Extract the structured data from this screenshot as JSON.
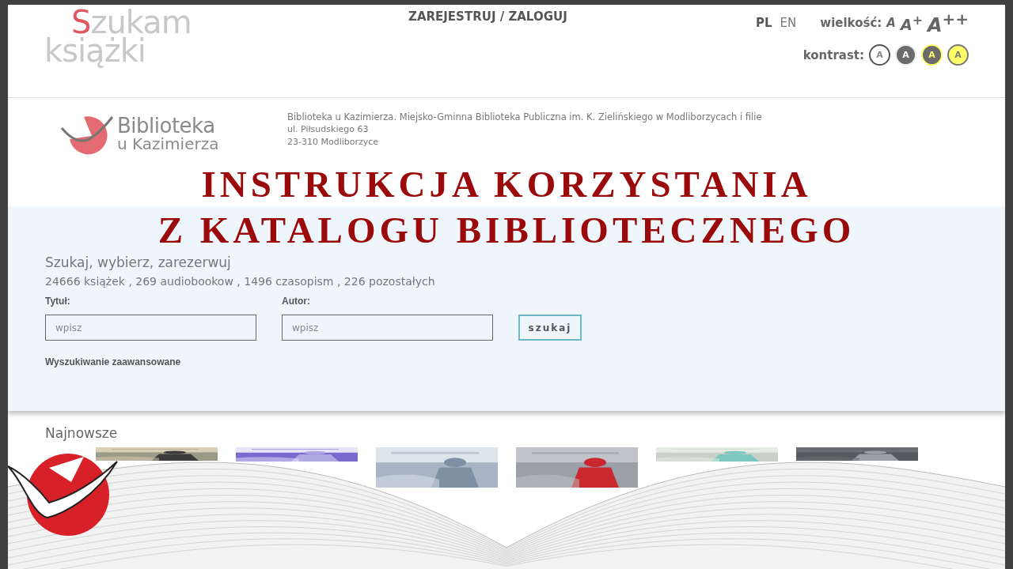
{
  "header": {
    "logo": {
      "line_1": "Szukam",
      "line_2": "książki"
    },
    "account_link": "ZAREJESTRUJ / ZALOGUJ",
    "languages": [
      {
        "label": "PL",
        "selected": true
      },
      {
        "label": "EN",
        "selected": false
      }
    ],
    "size_label": "wielkość:",
    "sizes": [
      "A",
      "A$^{+}$",
      "A$^{++}$"
    ],
    "contrast_label": "kontrast:",
    "contrast_options": [
      {
        "label": "A",
        "kind": "normal"
      },
      {
        "label": "A",
        "kind": "dark"
      },
      {
        "label": "A",
        "kind": "darkyellow"
      },
      {
        "label": "A",
        "kind": "yellow"
      }
    ]
  },
  "library": {
    "logo_line_1": "Biblioteka",
    "logo_line_2": "u Kazimierza",
    "name": "Biblioteka u Kazimierza. Miejsko-Gminna Biblioteka Publiczna im. K. Zielińskiego w Modliborzycach i filie",
    "address": [
      "ul. Piłsudskiego 63",
      "23-310 Modliborzyce"
    ]
  },
  "search": {
    "heading": "Szukaj, wybierz, zarezerwuj",
    "stats": "24666 książek , 269 audiobookow , 1496 czasopism , 226 pozostałych",
    "fields": [
      {
        "label": "Tytuł:",
        "placeholder": "wpisz"
      },
      {
        "label": "Autor:",
        "placeholder": "wpisz"
      }
    ],
    "button": "szukaj",
    "advanced_link": "Wyszukiwanie zaawansowane"
  },
  "newest": {
    "heading": "Najnowsze"
  },
  "overlay_title": [
    "INSTRUKCJA KORZYSTANIA",
    "Z KATALOGU BIBLIOTECZNEGO"
  ]
}
